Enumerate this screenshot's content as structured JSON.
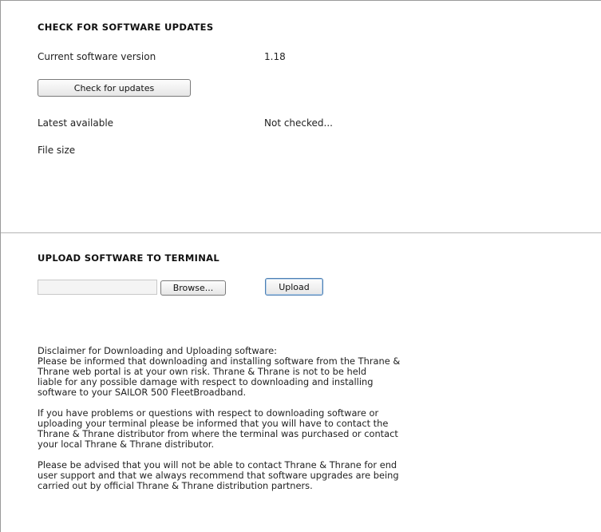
{
  "check_section": {
    "title": "CHECK FOR SOFTWARE UPDATES",
    "current_version_label": "Current software version",
    "current_version_value": "1.18",
    "check_button": "Check for updates",
    "latest_label": "Latest available",
    "latest_value": "Not checked...",
    "file_size_label": "File size"
  },
  "upload_section": {
    "title": "UPLOAD SOFTWARE TO TERMINAL",
    "file_value": "",
    "browse_button": "Browse...",
    "upload_button": "Upload"
  },
  "disclaimer": {
    "paragraph_1": "Disclaimer for Downloading and Uploading software:\nPlease be informed that downloading and installing software from the Thrane &\nThrane web portal is at your own risk. Thrane & Thrane is not to be held\nliable for any possible damage with respect to downloading and installing\nsoftware to your SAILOR 500 FleetBroadband.",
    "paragraph_2": "If you have problems or questions with respect to downloading software or\nuploading your terminal please be informed that you will have to contact the\nThrane & Thrane distributor from where the terminal was purchased or contact\nyour local Thrane & Thrane distributor.",
    "paragraph_3": "Please be advised that you will not be able to contact Thrane & Thrane for end\nuser support and that we always recommend that software upgrades are being\ncarried out by official Thrane & Thrane distribution partners."
  }
}
